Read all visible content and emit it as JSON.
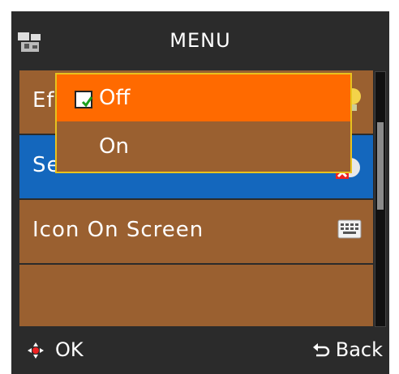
{
  "header": {
    "title": "MENU",
    "icon": "camera-menu-icon"
  },
  "menu_items": [
    {
      "label": "Ef",
      "icon": "effect-icon",
      "selected": false
    },
    {
      "label": "Self Timer",
      "icon": "self-timer-off-icon",
      "selected": true
    },
    {
      "label": "Icon On Screen",
      "icon": "keyboard-icon",
      "selected": false
    },
    {
      "label": "",
      "icon": "",
      "selected": false
    }
  ],
  "popup": {
    "options": [
      {
        "label": "Off",
        "checked": true,
        "highlighted": true
      },
      {
        "label": "On",
        "checked": false,
        "highlighted": false
      }
    ]
  },
  "footer": {
    "ok_label": "OK",
    "back_label": "Back"
  },
  "colors": {
    "row": "#9a6030",
    "selected_row": "#1467bd",
    "highlight": "#ff6a00",
    "popup_border": "#e8c21e"
  }
}
